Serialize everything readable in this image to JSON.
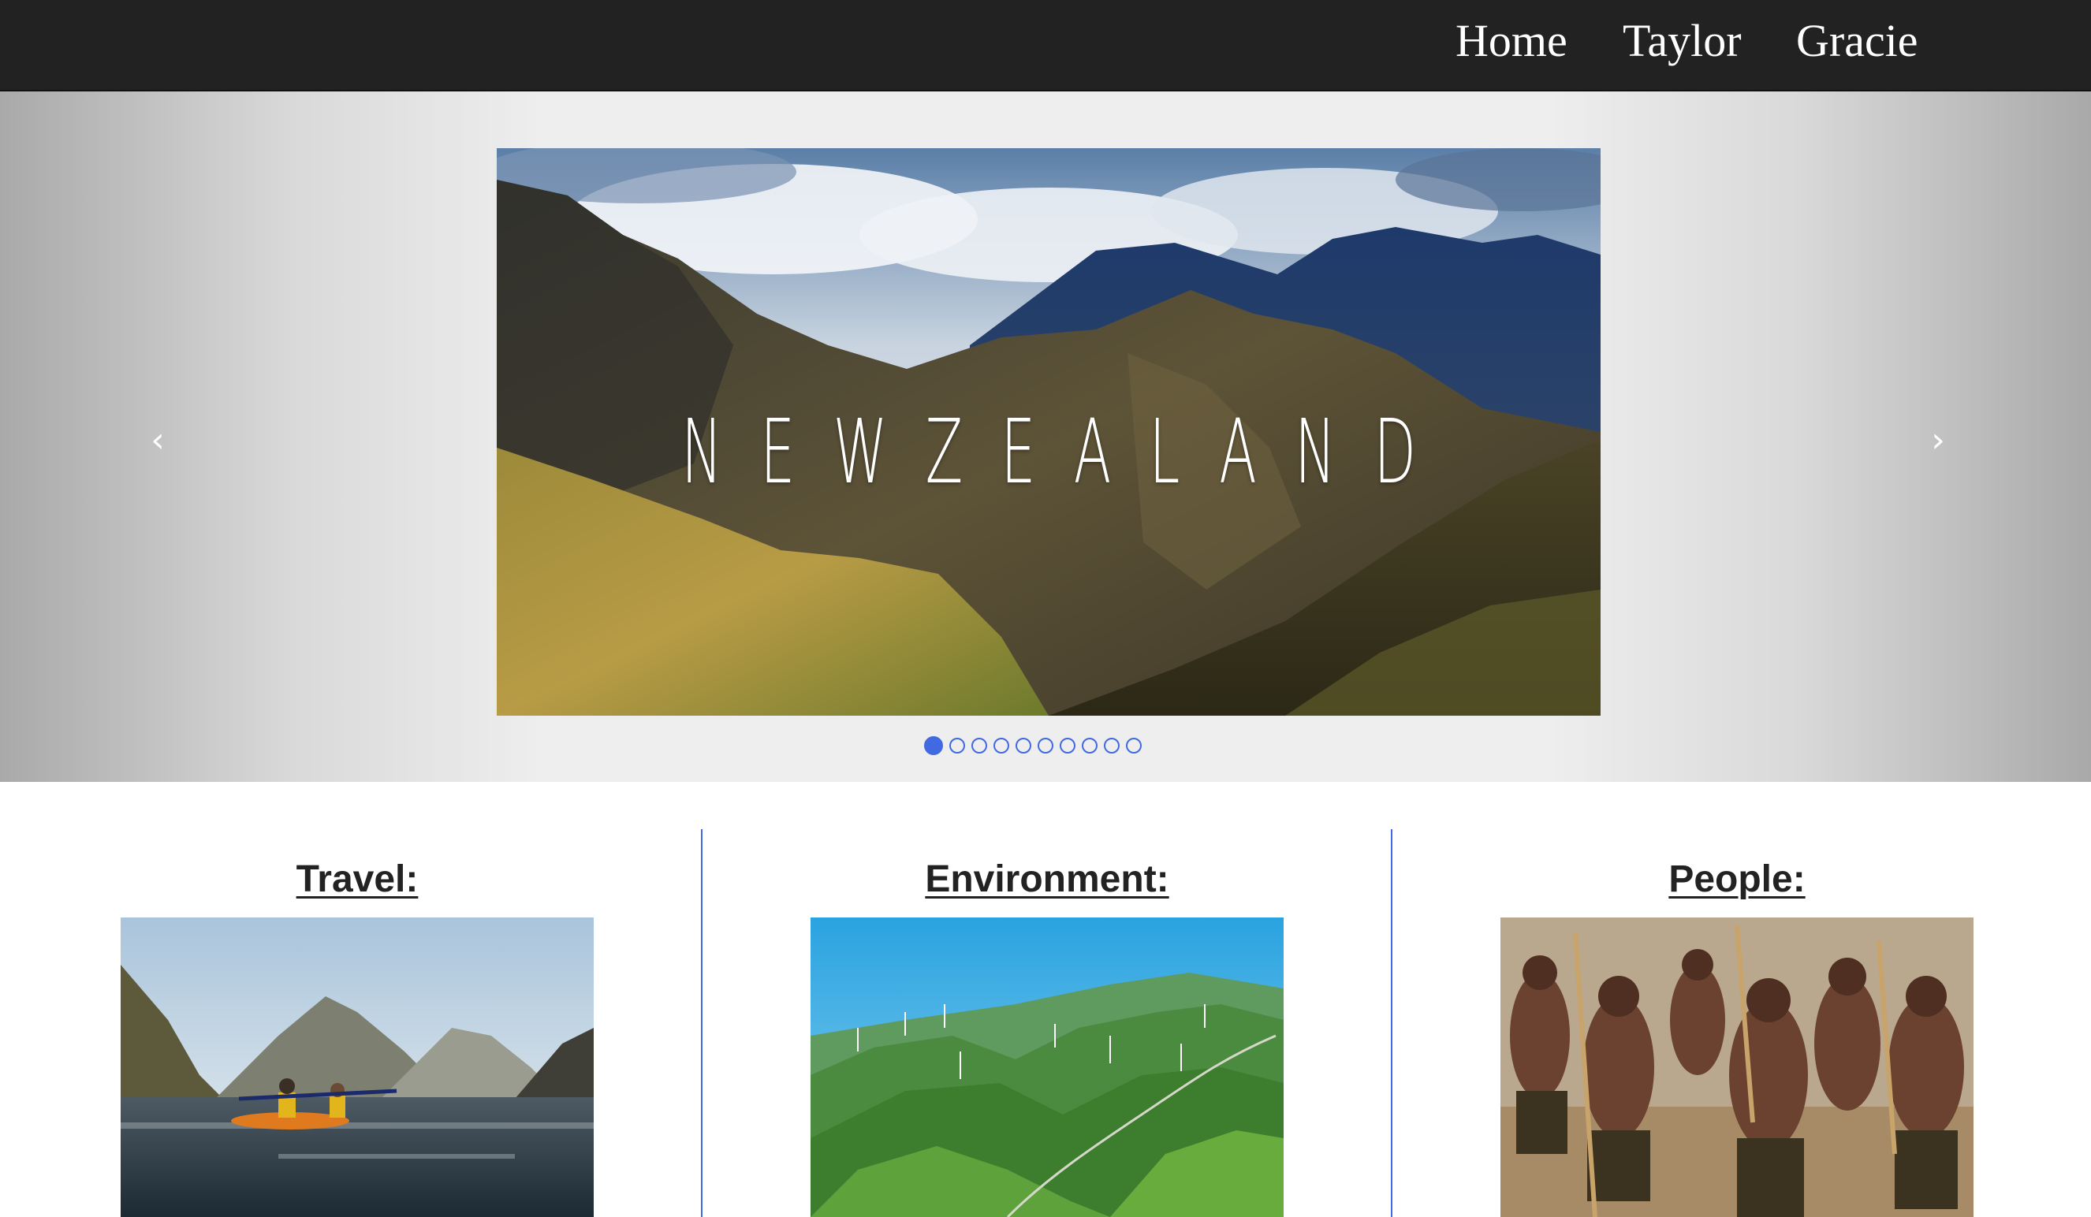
{
  "nav": {
    "links": [
      "Home",
      "Taylor",
      "Gracie"
    ]
  },
  "carousel": {
    "slide_title": "NEWZEALAND",
    "prev_icon": "‹",
    "next_icon": "›",
    "slide_count": 10,
    "active_index": 0,
    "accent_color": "#4169e1"
  },
  "sections": [
    {
      "title": "Travel:"
    },
    {
      "title": "Environment:"
    },
    {
      "title": "People:"
    }
  ],
  "colors": {
    "navbar_bg": "#222222",
    "divider": "#4169e1"
  }
}
